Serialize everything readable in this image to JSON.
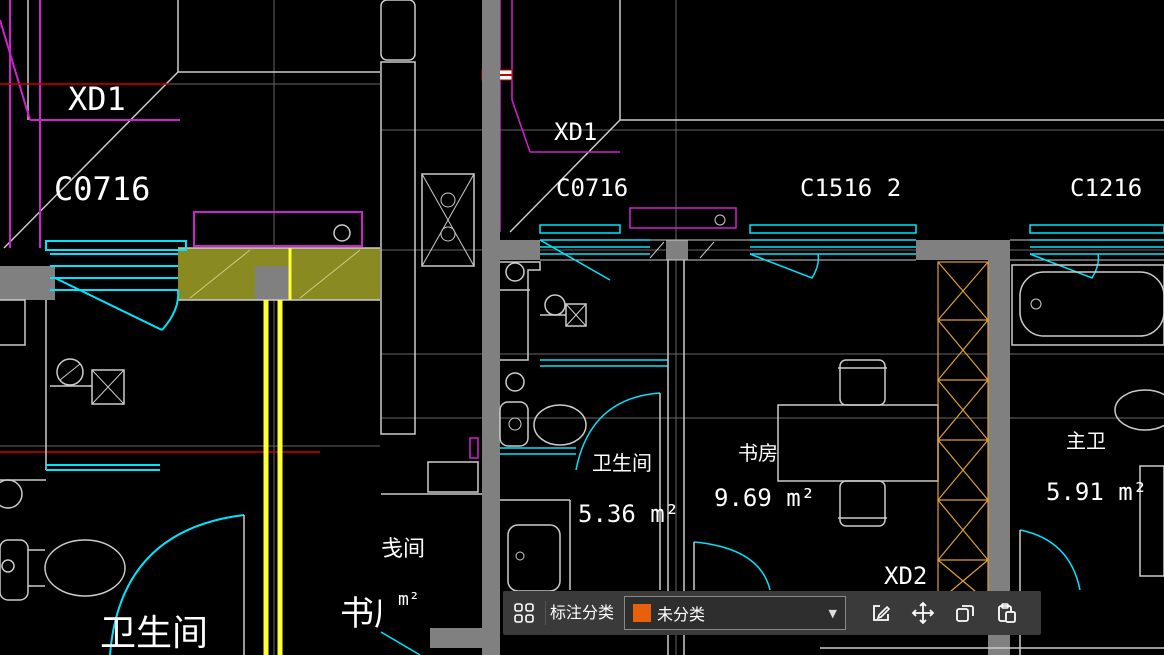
{
  "left_panel": {
    "labels": {
      "xd1": "XD1",
      "c0716": "C0716",
      "bathroom": "卫生间",
      "study_partial": "书房"
    }
  },
  "plan": {
    "labels": {
      "xd1": "XD1",
      "c0716": "C0716",
      "c1516": "C1516 2",
      "c1216": "C1216",
      "xd2": "XD2",
      "partial_room": "戋间",
      "partial_area": "m²"
    },
    "rooms": [
      {
        "name": "卫生间",
        "area": "5.36 m²"
      },
      {
        "name": "书房",
        "area": "9.69 m²"
      },
      {
        "name": "主卫",
        "area": "5.91 m²"
      }
    ]
  },
  "toolbar": {
    "label": "标注分类",
    "category_value": "未分类",
    "swatch_color": "#e8600c",
    "icons": [
      "apps-icon",
      "edit-icon",
      "move-icon",
      "copy-icon",
      "paste-icon"
    ]
  },
  "colors": {
    "wall": "#808080",
    "cyan": "#00e5ff",
    "magenta": "#d020d0",
    "yellow": "#ffff33",
    "olive": "#8a8a22",
    "orange": "#e0a030",
    "red": "#cc0000"
  }
}
